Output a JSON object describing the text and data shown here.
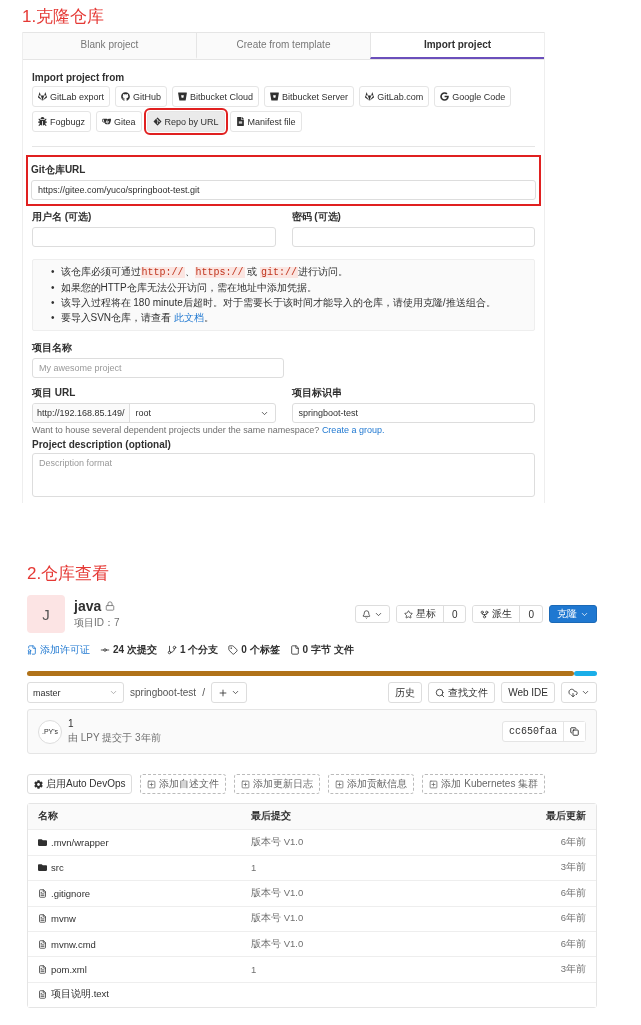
{
  "section_1": {
    "heading": "1.克隆仓库",
    "tabs": [
      {
        "label": "Blank project",
        "selected": false
      },
      {
        "label": "Create from template",
        "selected": false
      },
      {
        "label": "Import project",
        "selected": true
      }
    ],
    "import_from": {
      "label": "Import project from",
      "sources": [
        {
          "label": "GitLab export",
          "selected": false,
          "highlighted": false
        },
        {
          "label": "GitHub",
          "selected": false,
          "highlighted": false
        },
        {
          "label": "Bitbucket Cloud",
          "selected": false,
          "highlighted": false
        },
        {
          "label": "Bitbucket Server",
          "selected": false,
          "highlighted": false
        },
        {
          "label": "GitLab.com",
          "selected": false,
          "highlighted": false
        },
        {
          "label": "Google Code",
          "selected": false,
          "highlighted": false
        },
        {
          "label": "Fogbugz",
          "selected": false,
          "highlighted": false
        },
        {
          "label": "Gitea",
          "selected": false,
          "highlighted": false
        },
        {
          "label": "Repo by URL",
          "selected": true,
          "highlighted": true
        },
        {
          "label": "Manifest file",
          "selected": false,
          "highlighted": false
        }
      ]
    },
    "git_url": {
      "label": "Git仓库URL",
      "value": "https://gitee.com/yuco/springboot-test.git",
      "highlighted": true
    },
    "username": {
      "label": "用户名 (可选)"
    },
    "password": {
      "label": "密码 (可选)"
    },
    "notes": {
      "bullet": "•",
      "items": [
        [
          {
            "kind": "text",
            "text": "该仓库必须可通过"
          },
          {
            "kind": "code",
            "text": "http://"
          },
          {
            "kind": "text",
            "text": "、"
          },
          {
            "kind": "code",
            "text": "https://"
          },
          {
            "kind": "text",
            "text": " 或 "
          },
          {
            "kind": "code",
            "text": "git://"
          },
          {
            "kind": "text",
            "text": "进行访问。"
          }
        ],
        [
          {
            "kind": "text",
            "text": "如果您的HTTP仓库无法公开访问，需在地址中添加凭据。"
          }
        ],
        [
          {
            "kind": "text",
            "text": "该导入过程将在 180 minute后超时。对于需要长于该时间才能导入的仓库，请使用克隆/推送组合。"
          }
        ],
        [
          {
            "kind": "text",
            "text": "要导入SVN仓库，请查看 "
          },
          {
            "kind": "link",
            "text": "此文档"
          },
          {
            "kind": "text",
            "text": "。"
          }
        ]
      ]
    },
    "project_name": {
      "label": "项目名称",
      "placeholder": "My awesome project"
    },
    "project_url": {
      "label": "项目 URL",
      "prefix": "http://192.168.85.149/",
      "namespace": "root"
    },
    "project_slug": {
      "label": "项目标识串",
      "value": "springboot-test"
    },
    "namespace_hint": {
      "text": "Want to house several dependent projects under the same namespace?",
      "link": "Create a group."
    },
    "description": {
      "label": "Project description (optional)",
      "placeholder": "Description format"
    }
  },
  "section_2": {
    "heading": "2.仓库查看",
    "project": {
      "avatar": "J",
      "name": "java",
      "private": true,
      "id": "项目ID：7"
    },
    "header_buttons": {
      "star_label": "星标",
      "star_count": "0",
      "fork_label": "派生",
      "fork_count": "0",
      "clone_label": "克隆"
    },
    "stats": [
      {
        "kind": "license",
        "text": "添加许可证"
      },
      {
        "kind": "commits",
        "text": "24 次提交"
      },
      {
        "kind": "branches",
        "text": "1 个分支"
      },
      {
        "kind": "tags",
        "text": "0 个标签"
      },
      {
        "kind": "files",
        "text": "0 字节 文件"
      }
    ],
    "languages": [
      {
        "color": "#b07219",
        "level": 0.96
      },
      {
        "color": "#1aaee8",
        "level": 0.04
      }
    ],
    "toolbar": {
      "branch": "master",
      "path": "springboot-test",
      "separator": "/",
      "history": "历史",
      "find_file": "查找文件",
      "web_ide": "Web IDE"
    },
    "last_commit": {
      "avatar_alt": ".PY's",
      "title": "1",
      "meta": "由 LPY 提交于 3年前",
      "sha": "cc650faa"
    },
    "actions": [
      {
        "kind": "primary",
        "label": "启用Auto DevOps"
      },
      {
        "kind": "dashed",
        "label": "添加自述文件"
      },
      {
        "kind": "dashed",
        "label": "添加更新日志"
      },
      {
        "kind": "dashed",
        "label": "添加贡献信息"
      },
      {
        "kind": "dashed",
        "label": "添加 Kubernetes 集群"
      }
    ],
    "table": {
      "columns": [
        "名称",
        "最后提交",
        "最后更新"
      ],
      "rows": [
        {
          "kind": "folder",
          "name": ".mvn/wrapper",
          "commit": "版本号 V1.0",
          "updated": "6年前"
        },
        {
          "kind": "folder",
          "name": "src",
          "commit": "1",
          "updated": "3年前"
        },
        {
          "kind": "file",
          "name": ".gitignore",
          "commit": "版本号 V1.0",
          "updated": "6年前"
        },
        {
          "kind": "file",
          "name": "mvnw",
          "commit": "版本号 V1.0",
          "updated": "6年前"
        },
        {
          "kind": "file",
          "name": "mvnw.cmd",
          "commit": "版本号 V1.0",
          "updated": "6年前"
        },
        {
          "kind": "file",
          "name": "pom.xml",
          "commit": "1",
          "updated": "3年前"
        },
        {
          "kind": "file",
          "name": "项目说明.text"
        }
      ]
    }
  }
}
